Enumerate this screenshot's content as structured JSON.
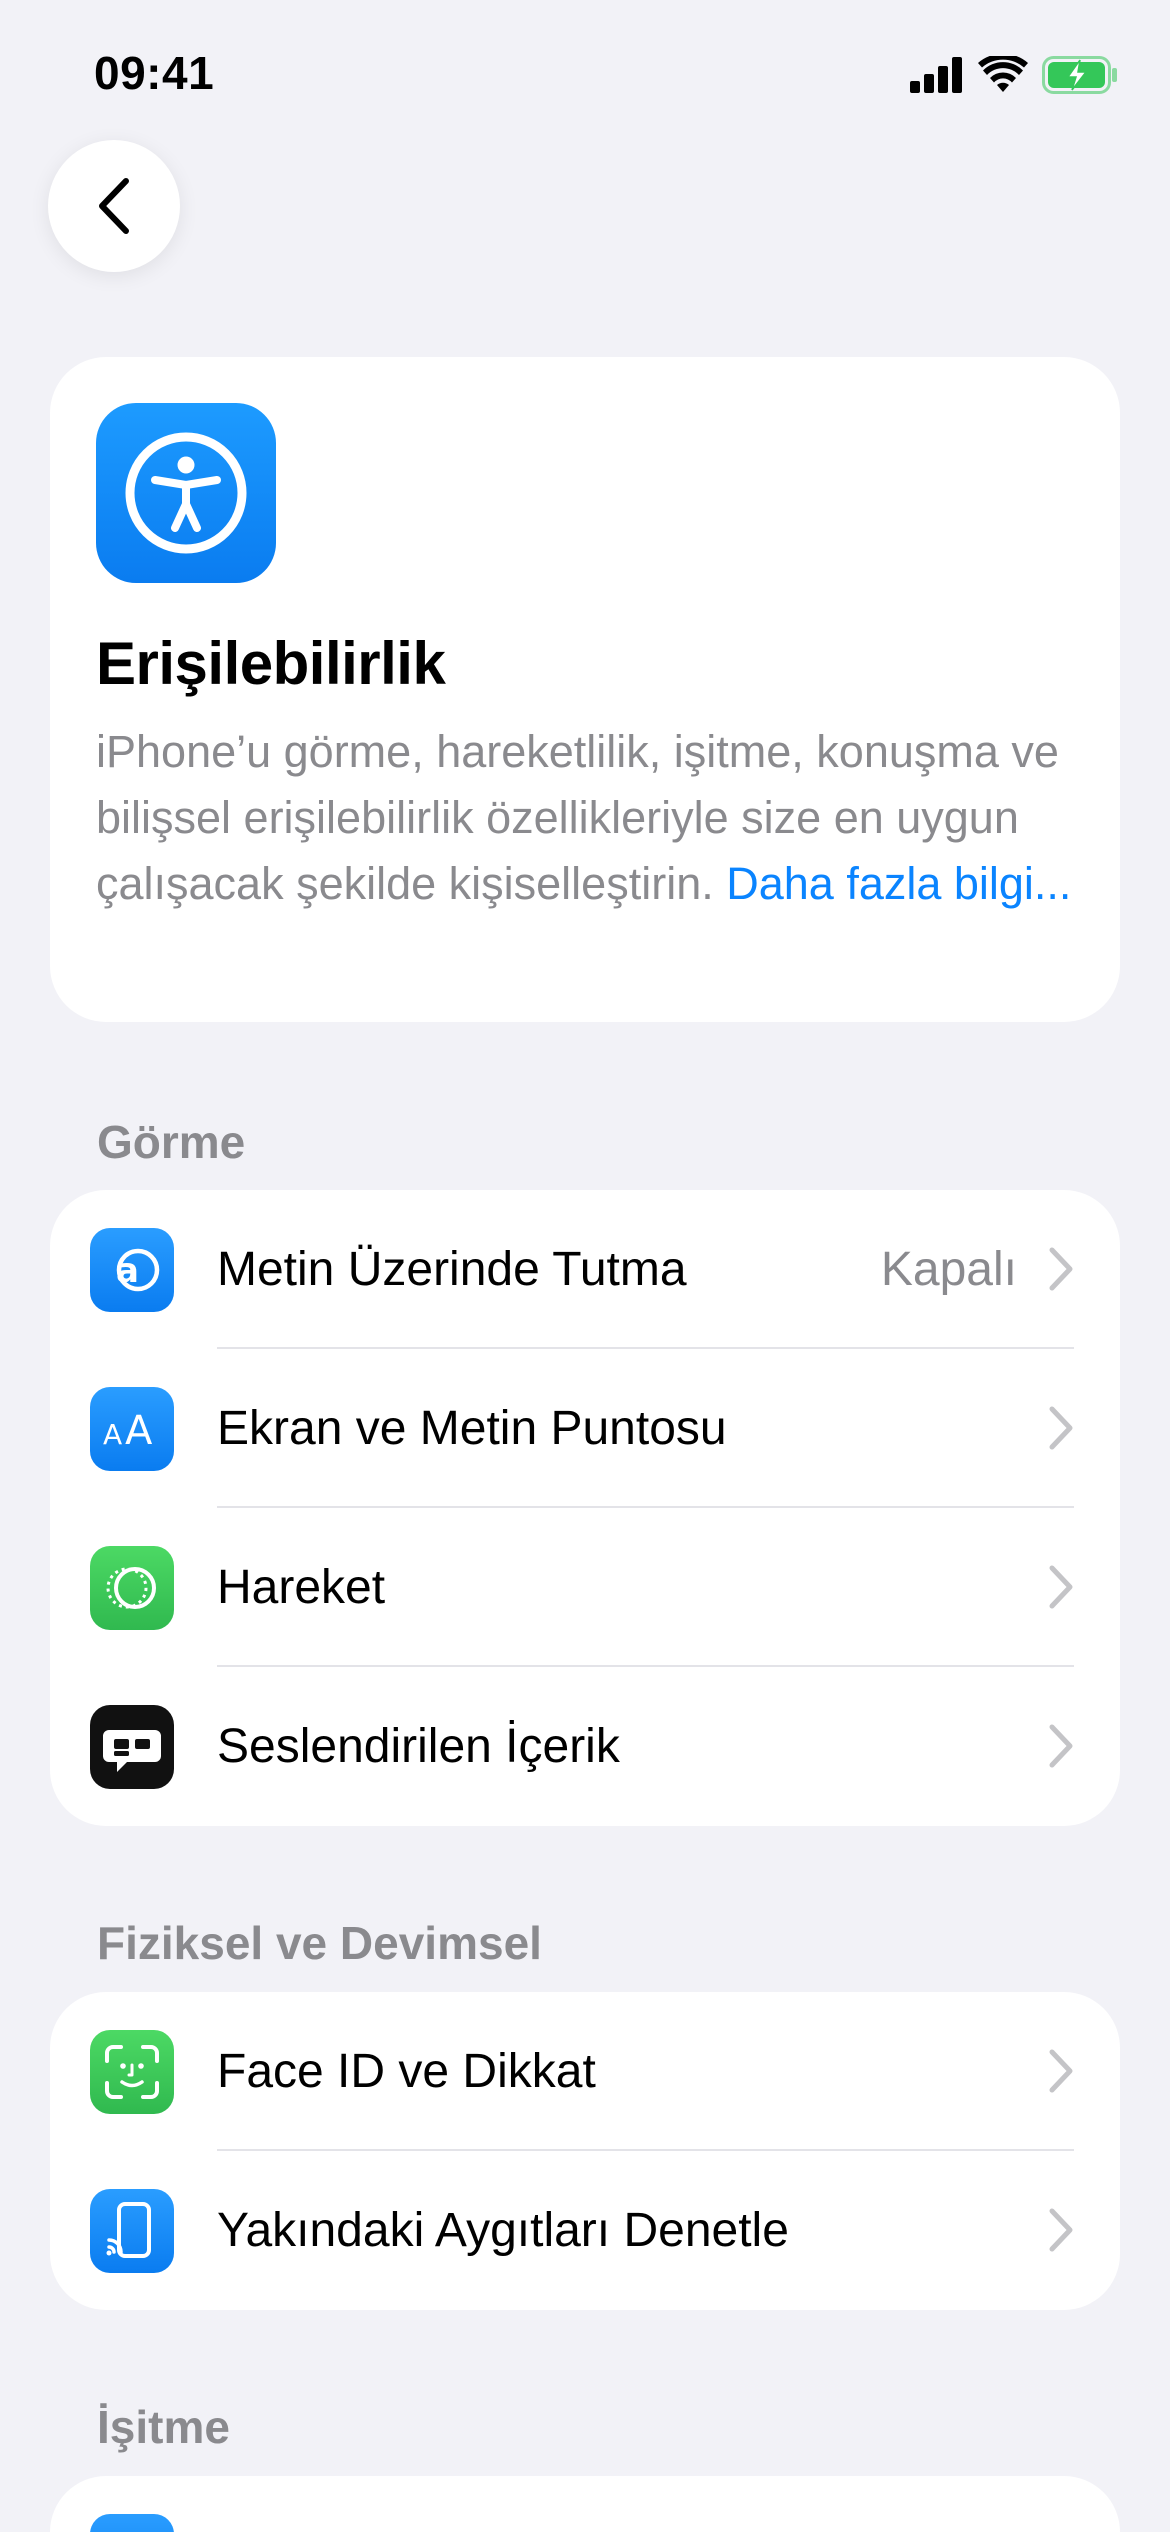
{
  "status_bar": {
    "time": "09:41",
    "icons": [
      "cellular-signal-icon",
      "wifi-icon",
      "battery-charging-icon"
    ]
  },
  "nav": {
    "back_icon": "chevron-left-icon"
  },
  "header": {
    "icon": "accessibility-icon",
    "title": "Erişilebilirlik",
    "description": "iPhone’u görme, hareketlilik, işitme, konuşma ve bilişsel erişilebilirlik özellikleriyle size en uygun çalışacak şekilde kişiselleştirin. ",
    "link": "Daha fazla bilgi..."
  },
  "sections": {
    "vision": {
      "title": "Görme",
      "items": [
        {
          "label": "Metin Üzerinde Tutma",
          "value": "Kapalı",
          "icon": "hover-text-icon",
          "color": "#1e90ff"
        },
        {
          "label": "Ekran ve Metin Puntosu",
          "value": "",
          "icon": "text-size-icon",
          "color": "#1e90ff"
        },
        {
          "label": "Hareket",
          "value": "",
          "icon": "motion-icon",
          "color": "#34c759"
        },
        {
          "label": "Seslendirilen İçerik",
          "value": "",
          "icon": "spoken-content-icon",
          "color": "#111111"
        }
      ]
    },
    "physical": {
      "title": "Fiziksel ve Devimsel",
      "items": [
        {
          "label": "Face ID ve Dikkat",
          "value": "",
          "icon": "face-id-icon",
          "color": "#34c759"
        },
        {
          "label": "Yakındaki Aygıtları Denetle",
          "value": "",
          "icon": "nearby-devices-icon",
          "color": "#1e90ff"
        }
      ]
    },
    "hearing": {
      "title": "İşitme"
    }
  },
  "colors": {
    "background": "#f2f2f7",
    "accent": "#0a84ff",
    "secondary_text": "#8a8a8e",
    "battery": "#34c759"
  }
}
